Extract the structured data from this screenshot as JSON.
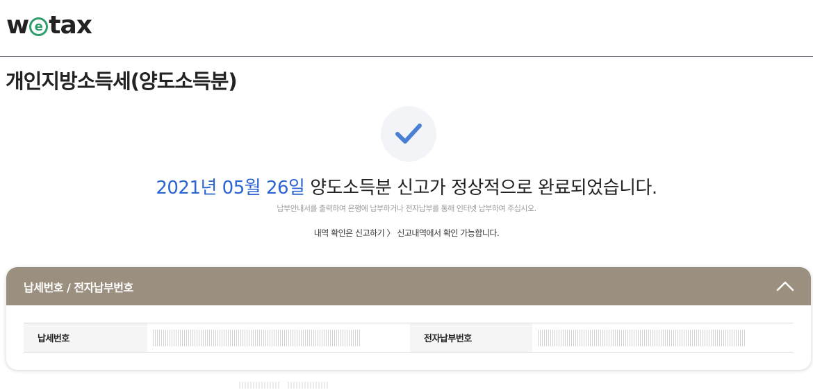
{
  "header": {
    "logo_prefix": "w",
    "logo_e": "e",
    "logo_suffix": "tax"
  },
  "page_title": "개인지방소득세(양도소득분)",
  "result": {
    "date": "2021년 05월 26일",
    "message": " 양도소득분 신고가 정상적으로 완료되었습니다.",
    "sub_message": "납부안내서를 출력하여 은행에 납부하거나 전자납부를 통해 인터넷 납부하여 주십시오.",
    "info_message": "내역 확인은 신고하기 〉 신고내역에서 확인 가능합니다."
  },
  "panel": {
    "title": "납세번호 / 전자납부번호",
    "fields": [
      {
        "label": "납세번호"
      },
      {
        "label": "전자납부번호"
      }
    ]
  },
  "icons": {
    "check": "check-icon",
    "collapse": "chevron-up-icon"
  },
  "colors": {
    "accent_blue": "#2b64d3",
    "check_blue": "#4a7fd6",
    "panel_header": "#9b9080",
    "logo_green": "#2e9d6b"
  }
}
